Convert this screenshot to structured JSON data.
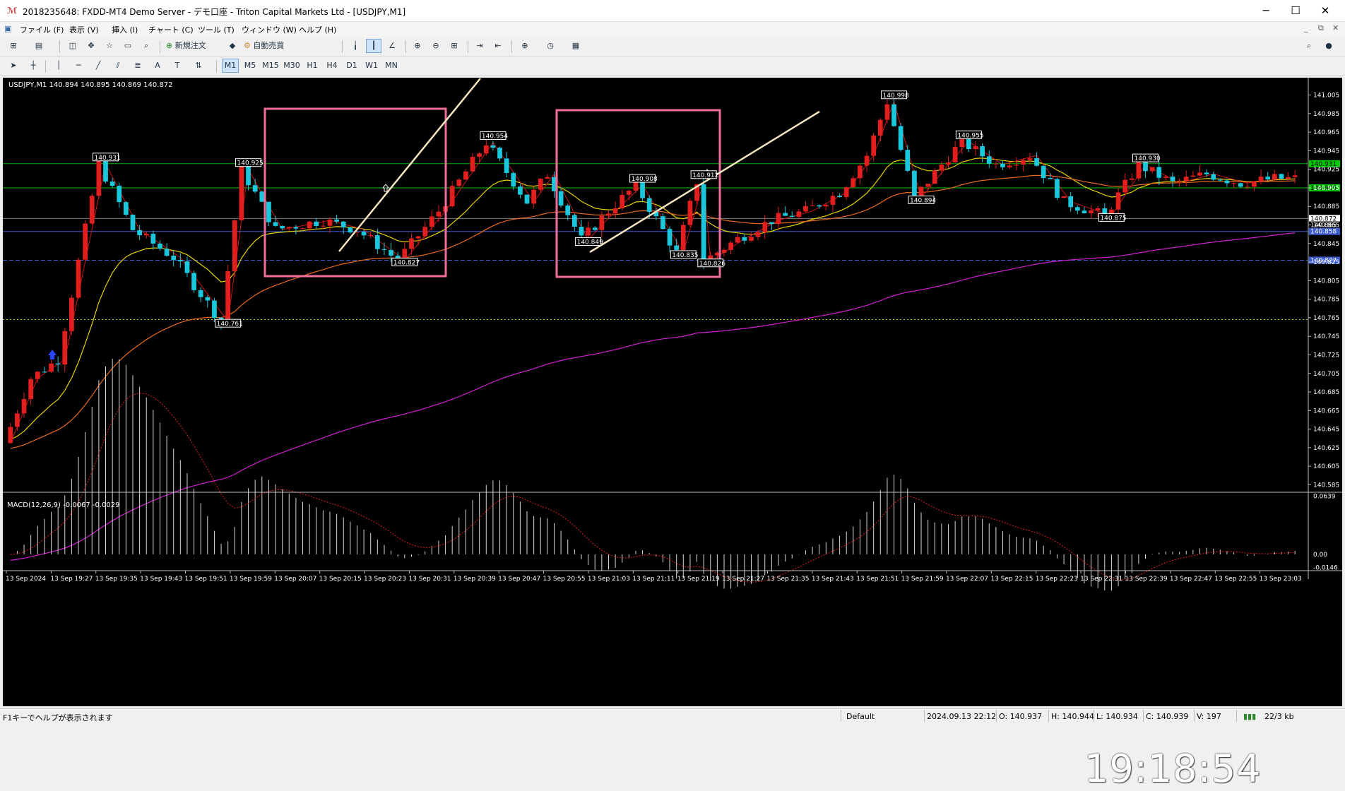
{
  "window": {
    "title": "2018235648: FXDD-MT4 Demo Server - デモ口座 - Triton Capital Markets Ltd - [USDJPY,M1]",
    "minimize": "─",
    "maximize": "☐",
    "close": "✕"
  },
  "menu": {
    "items": [
      "ファイル (F)",
      "表示 (V)",
      "挿入 (I)",
      "チャート (C)",
      "ツール (T)",
      "ウィンドウ (W)",
      "ヘルプ (H)"
    ],
    "right_controls": [
      "_",
      "⧉",
      "✕"
    ]
  },
  "toolbar1": {
    "new_order": "新規注文",
    "auto_trade": "自動売買"
  },
  "toolbar2": {
    "periods": [
      "M1",
      "M5",
      "M15",
      "M30",
      "H1",
      "H4",
      "D1",
      "W1",
      "MN"
    ]
  },
  "chart": {
    "header": "USDJPY,M1  140.894 140.895 140.869 140.872",
    "macd_header": "MACD(12,26,9) -0.0067 -0.0029",
    "price_axis": [
      "141.005",
      "140.985",
      "140.965",
      "140.945",
      "140.925",
      "140.905",
      "140.885",
      "140.865",
      "140.845",
      "140.825",
      "140.805",
      "140.785",
      "140.765",
      "140.745",
      "140.725",
      "140.705",
      "140.685",
      "140.665",
      "140.645",
      "140.625",
      "140.605",
      "140.585"
    ],
    "macd_axis": [
      "0.0639",
      "0.00",
      "-0.0146"
    ],
    "time_axis": [
      "13 Sep 2024",
      "13 Sep 19:27",
      "13 Sep 19:35",
      "13 Sep 19:43",
      "13 Sep 19:51",
      "13 Sep 19:59",
      "13 Sep 20:07",
      "13 Sep 20:15",
      "13 Sep 20:23",
      "13 Sep 20:31",
      "13 Sep 20:39",
      "13 Sep 20:47",
      "13 Sep 20:55",
      "13 Sep 21:03",
      "13 Sep 21:11",
      "13 Sep 21:19",
      "13 Sep 21:27",
      "13 Sep 21:35",
      "13 Sep 21:43",
      "13 Sep 21:51",
      "13 Sep 21:59",
      "13 Sep 22:07",
      "13 Sep 22:15",
      "13 Sep 22:23",
      "13 Sep 22:31",
      "13 Sep 22:39",
      "13 Sep 22:47",
      "13 Sep 22:55",
      "13 Sep 23:03"
    ],
    "level_tags": [
      {
        "text": "140.931",
        "price": 140.931,
        "bg": "#00c800",
        "color": "#000"
      },
      {
        "text": "140.905",
        "price": 140.905,
        "bg": "#00c800",
        "color": "#000"
      },
      {
        "text": "140.872",
        "price": 140.872,
        "bg": "#ffffff",
        "color": "#000"
      },
      {
        "text": "140.865",
        "price": 140.865,
        "bg": "#000000",
        "color": "#fff"
      },
      {
        "text": "140.858",
        "price": 140.858,
        "bg": "#3a5ad0",
        "color": "#fff"
      },
      {
        "text": "140.827",
        "price": 140.827,
        "bg": "#3a5ad0",
        "color": "#fff"
      }
    ],
    "point_labels": [
      {
        "text": "140.931",
        "t": 14,
        "price": 140.931
      },
      {
        "text": "140.925",
        "t": 35,
        "price": 140.925
      },
      {
        "text": "140.761",
        "t": 32,
        "price": 140.761
      },
      {
        "text": "140.827",
        "t": 58,
        "price": 140.827
      },
      {
        "text": "140.954",
        "t": 71,
        "price": 140.954
      },
      {
        "text": "140.849",
        "t": 85,
        "price": 140.849
      },
      {
        "text": "140.908",
        "t": 93,
        "price": 140.908
      },
      {
        "text": "140.912",
        "t": 102,
        "price": 140.912
      },
      {
        "text": "140.835",
        "t": 99,
        "price": 140.835
      },
      {
        "text": "140.826",
        "t": 103,
        "price": 140.826
      },
      {
        "text": "140.998",
        "t": 130,
        "price": 140.998
      },
      {
        "text": "140.894",
        "t": 134,
        "price": 140.894
      },
      {
        "text": "140.955",
        "t": 141,
        "price": 140.955
      },
      {
        "text": "140.930",
        "t": 167,
        "price": 140.93
      },
      {
        "text": "140.875",
        "t": 162,
        "price": 140.875
      }
    ]
  },
  "chart_data": {
    "type": "candlestick",
    "symbol": "USDJPY",
    "timeframe": "M1",
    "ylim": [
      140.58,
      141.01
    ],
    "macd_ylim": [
      -0.018,
      0.066
    ],
    "key_points": [
      [
        0,
        140.63
      ],
      [
        4,
        140.7
      ],
      [
        8,
        140.72
      ],
      [
        14,
        140.931
      ],
      [
        19,
        140.86
      ],
      [
        25,
        140.83
      ],
      [
        32,
        140.761
      ],
      [
        35,
        140.925
      ],
      [
        40,
        140.86
      ],
      [
        47,
        140.87
      ],
      [
        52,
        140.86
      ],
      [
        58,
        140.827
      ],
      [
        64,
        140.88
      ],
      [
        71,
        140.954
      ],
      [
        77,
        140.89
      ],
      [
        80,
        140.92
      ],
      [
        85,
        140.849
      ],
      [
        89,
        140.88
      ],
      [
        93,
        140.908
      ],
      [
        99,
        140.835
      ],
      [
        102,
        140.912
      ],
      [
        103,
        140.826
      ],
      [
        108,
        140.85
      ],
      [
        113,
        140.87
      ],
      [
        118,
        140.88
      ],
      [
        123,
        140.9
      ],
      [
        127,
        140.94
      ],
      [
        130,
        140.998
      ],
      [
        134,
        140.894
      ],
      [
        138,
        140.93
      ],
      [
        141,
        140.955
      ],
      [
        146,
        140.93
      ],
      [
        151,
        140.94
      ],
      [
        156,
        140.89
      ],
      [
        162,
        140.875
      ],
      [
        167,
        140.93
      ],
      [
        172,
        140.91
      ],
      [
        177,
        140.92
      ],
      [
        182,
        140.91
      ],
      [
        187,
        140.915
      ]
    ]
  },
  "status": {
    "help": "F1キーでヘルプが表示されます",
    "profile": "Default",
    "datetime": "2024.09.13 22:12",
    "open": "O: 140.937",
    "high": "H: 140.944",
    "low": "L: 140.934",
    "close": "C: 140.939",
    "volume": "V: 197",
    "traffic": "22/3 kb"
  },
  "clock": "19:18:54"
}
